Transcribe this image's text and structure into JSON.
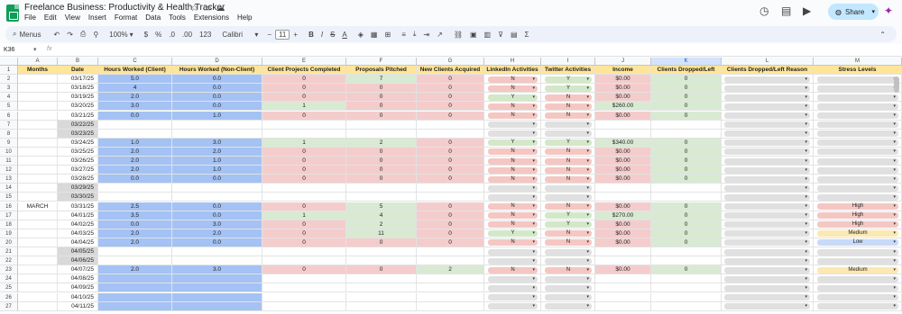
{
  "app": {
    "title": "Freelance Business: Productivity & Health Tracker",
    "menus": [
      "File",
      "Edit",
      "View",
      "Insert",
      "Format",
      "Data",
      "Tools",
      "Extensions",
      "Help"
    ],
    "share_label": "Share",
    "brand_color": "#0f9d58"
  },
  "toolbar": {
    "search_label": "Menus",
    "zoom": "100%",
    "currency": "$",
    "percent": "%",
    "decimal_dec": ".0",
    "decimal_inc": ".00",
    "number_format": "123",
    "font": "Calibri",
    "font_size": "11"
  },
  "formula_bar": {
    "name_box": "K36",
    "fx": "fx"
  },
  "columns": [
    "A",
    "B",
    "C",
    "D",
    "E",
    "F",
    "G",
    "H",
    "I",
    "J",
    "K",
    "L",
    "M"
  ],
  "selected_column": "K",
  "headers": [
    "Months",
    "Date",
    "Hours Worked (Client)",
    "Hours Worked (Non-Client)",
    "Client Projects Completed",
    "Proposals Pitched",
    "New Clients Acquired",
    "LinkedIn Activities",
    "Twitter Activities",
    "Income",
    "Clients Dropped/Left",
    "Clients Dropped/Left Reason",
    "Stress Levels"
  ],
  "month_label": "MARCH",
  "rows": [
    {
      "n": "2",
      "date": "03/17/25",
      "c": "5.0",
      "d": "0.0",
      "e": "0",
      "f": "7",
      "g": "0",
      "h": "N",
      "i": "Y",
      "j": "$0.00",
      "k": "0",
      "m": ""
    },
    {
      "n": "3",
      "date": "03/18/25",
      "c": "4",
      "d": "0.0",
      "e": "0",
      "f": "0",
      "g": "0",
      "h": "N",
      "i": "Y",
      "j": "$0.00",
      "k": "0",
      "m": ""
    },
    {
      "n": "4",
      "date": "03/19/25",
      "c": "2.0",
      "d": "0.0",
      "e": "0",
      "f": "0",
      "g": "0",
      "h": "Y",
      "i": "N",
      "j": "$0.00",
      "k": "0",
      "m": ""
    },
    {
      "n": "5",
      "date": "03/20/25",
      "c": "3.0",
      "d": "0.0",
      "e": "1",
      "f": "0",
      "g": "0",
      "h": "N",
      "i": "N",
      "j": "$260.00",
      "k": "0",
      "m": ""
    },
    {
      "n": "6",
      "date": "03/21/25",
      "c": "0.0",
      "d": "1.0",
      "e": "0",
      "f": "0",
      "g": "0",
      "h": "N",
      "i": "N",
      "j": "$0.00",
      "k": "0",
      "m": ""
    },
    {
      "n": "7",
      "date": "03/22/25",
      "weekend": true
    },
    {
      "n": "8",
      "date": "03/23/25",
      "weekend": true
    },
    {
      "n": "9",
      "date": "03/24/25",
      "c": "1.0",
      "d": "3.0",
      "e": "1",
      "f": "2",
      "g": "0",
      "h": "Y",
      "i": "Y",
      "j": "$340.00",
      "k": "0",
      "m": ""
    },
    {
      "n": "10",
      "date": "03/25/25",
      "c": "2.0",
      "d": "2.0",
      "e": "0",
      "f": "0",
      "g": "0",
      "h": "N",
      "i": "N",
      "j": "$0.00",
      "k": "0",
      "m": ""
    },
    {
      "n": "11",
      "date": "03/26/25",
      "c": "2.0",
      "d": "1.0",
      "e": "0",
      "f": "0",
      "g": "0",
      "h": "N",
      "i": "N",
      "j": "$0.00",
      "k": "0",
      "m": ""
    },
    {
      "n": "12",
      "date": "03/27/25",
      "c": "2.0",
      "d": "1.0",
      "e": "0",
      "f": "0",
      "g": "0",
      "h": "N",
      "i": "N",
      "j": "$0.00",
      "k": "0",
      "m": ""
    },
    {
      "n": "13",
      "date": "03/28/25",
      "c": "0.0",
      "d": "0.0",
      "e": "0",
      "f": "0",
      "g": "0",
      "h": "N",
      "i": "N",
      "j": "$0.00",
      "k": "0",
      "m": ""
    },
    {
      "n": "14",
      "date": "03/29/25",
      "weekend": true
    },
    {
      "n": "15",
      "date": "03/30/25",
      "weekend": true
    },
    {
      "n": "16",
      "date": "03/31/25",
      "c": "2.5",
      "d": "0.0",
      "e": "0",
      "f": "5",
      "g": "0",
      "h": "N",
      "i": "N",
      "j": "$0.00",
      "k": "0",
      "m": "High"
    },
    {
      "n": "17",
      "date": "04/01/25",
      "c": "3.5",
      "d": "0.0",
      "e": "1",
      "f": "4",
      "g": "0",
      "h": "N",
      "i": "Y",
      "j": "$270.00",
      "k": "0",
      "m": "High"
    },
    {
      "n": "18",
      "date": "04/02/25",
      "c": "0.0",
      "d": "3.0",
      "e": "0",
      "f": "2",
      "g": "0",
      "h": "N",
      "i": "Y",
      "j": "$0.00",
      "k": "0",
      "m": "High"
    },
    {
      "n": "19",
      "date": "04/03/25",
      "c": "2.0",
      "d": "2.0",
      "e": "0",
      "f": "11",
      "g": "0",
      "h": "Y",
      "i": "N",
      "j": "$0.00",
      "k": "0",
      "m": "Medium"
    },
    {
      "n": "20",
      "date": "04/04/25",
      "c": "2.0",
      "d": "0.0",
      "e": "0",
      "f": "0",
      "g": "0",
      "h": "N",
      "i": "N",
      "j": "$0.00",
      "k": "0",
      "m": "Low"
    },
    {
      "n": "21",
      "date": "04/05/25",
      "weekend": true
    },
    {
      "n": "22",
      "date": "04/06/25",
      "weekend": true
    },
    {
      "n": "23",
      "date": "04/07/25",
      "c": "2.0",
      "d": "3.0",
      "e": "0",
      "f": "0",
      "g": "2",
      "h": "N",
      "i": "N",
      "j": "$0.00",
      "k": "0",
      "m": "Medium"
    },
    {
      "n": "24",
      "date": "04/08/25",
      "future": true
    },
    {
      "n": "25",
      "date": "04/09/25",
      "future": true
    },
    {
      "n": "26",
      "date": "04/10/25",
      "future": true
    },
    {
      "n": "27",
      "date": "04/11/25",
      "future": true
    }
  ],
  "colors": {
    "header": "#ffe599",
    "hours": "#a4c2f4",
    "red": "#f4cccc",
    "green": "#d9ead3",
    "weekend": "#d9d9d9",
    "chip_gray": "#e0e0e0",
    "chip_red": "#f4c7c3",
    "chip_green": "#d3e8c8",
    "stress_high": "#f4c7c3",
    "stress_medium": "#fce8b2",
    "stress_low": "#c9daf8"
  }
}
